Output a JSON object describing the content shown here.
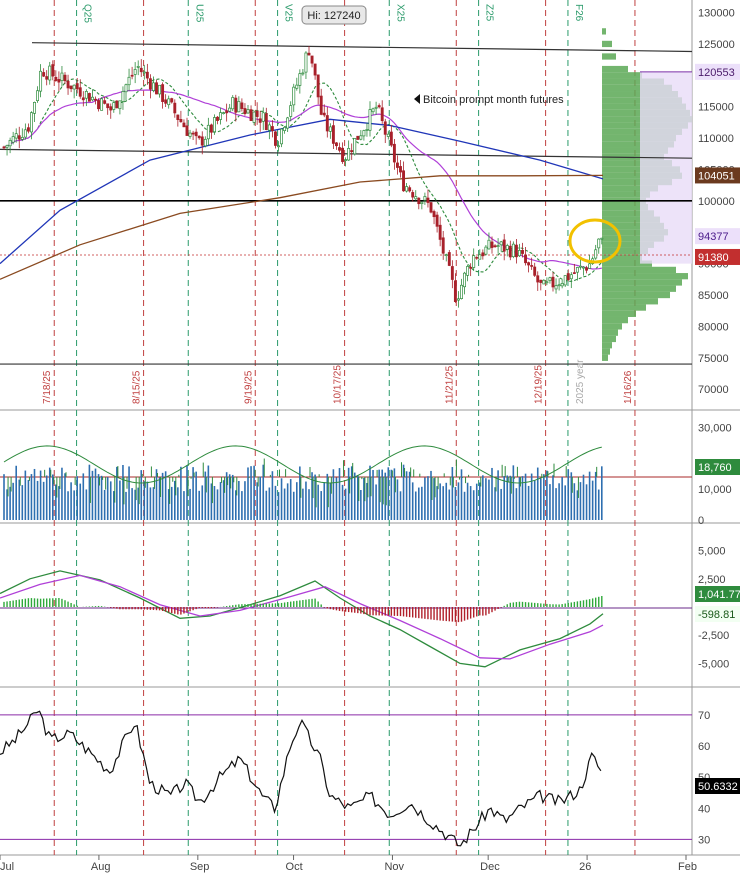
{
  "chart_data": [
    {
      "panel": "price",
      "type": "candlestick",
      "annotation": "Bitcoin prompt month futures",
      "high_label": "Hi: 127240",
      "ylim": [
        67000,
        132000
      ],
      "yticks": [
        130000,
        125000,
        120000,
        115000,
        110000,
        105000,
        100000,
        95000,
        90000,
        85000,
        80000,
        75000,
        70000
      ],
      "ytick_labels": [
        "130000",
        "125000",
        "120000",
        "115000",
        "110000",
        "105000",
        "100000",
        "95000",
        "90000",
        "85000",
        "80000",
        "75000",
        "70000"
      ],
      "price_tags": [
        {
          "label": "120553",
          "value": 120553,
          "color": "#7b2fa8"
        },
        {
          "label": "104051",
          "value": 104051,
          "color": "#6b3a1f"
        },
        {
          "label": "94377",
          "value": 94377,
          "color": "#6a49c8"
        },
        {
          "label": "91380",
          "value": 91380,
          "color": "#c22f2f"
        }
      ],
      "expiry_labels": [
        "Q25",
        "U25",
        "V25",
        "X25",
        "Z25",
        "F26"
      ],
      "date_labels": [
        "7/18/25",
        "8/15/25",
        "9/19/25",
        "10/17/25",
        "11/21/25",
        "12/19/25",
        "2025 year",
        "1/16/26"
      ],
      "close_points": [
        {
          "x": "2025-07-01",
          "y": 108000
        },
        {
          "x": "2025-07-10",
          "y": 112000
        },
        {
          "x": "2025-07-14",
          "y": 121000
        },
        {
          "x": "2025-07-25",
          "y": 118000
        },
        {
          "x": "2025-08-05",
          "y": 114500
        },
        {
          "x": "2025-08-13",
          "y": 121500
        },
        {
          "x": "2025-08-22",
          "y": 116000
        },
        {
          "x": "2025-09-01",
          "y": 109000
        },
        {
          "x": "2025-09-12",
          "y": 115500
        },
        {
          "x": "2025-09-22",
          "y": 113000
        },
        {
          "x": "2025-09-26",
          "y": 109500
        },
        {
          "x": "2025-10-06",
          "y": 124500
        },
        {
          "x": "2025-10-10",
          "y": 113000
        },
        {
          "x": "2025-10-17",
          "y": 107000
        },
        {
          "x": "2025-10-27",
          "y": 115000
        },
        {
          "x": "2025-11-04",
          "y": 103000
        },
        {
          "x": "2025-11-13",
          "y": 99000
        },
        {
          "x": "2025-11-21",
          "y": 84500
        },
        {
          "x": "2025-11-26",
          "y": 91000
        },
        {
          "x": "2025-12-03",
          "y": 93000
        },
        {
          "x": "2025-12-10",
          "y": 92000
        },
        {
          "x": "2025-12-18",
          "y": 86000
        },
        {
          "x": "2025-12-26",
          "y": 88000
        },
        {
          "x": "2026-01-02",
          "y": 90000
        },
        {
          "x": "2026-01-05",
          "y": 94000
        },
        {
          "x": "2026-01-07",
          "y": 91380
        }
      ]
    },
    {
      "panel": "volume",
      "type": "bar",
      "ylim": [
        0,
        35000
      ],
      "yticks": [
        30000,
        10000,
        0
      ],
      "ytick_labels": [
        "30,000",
        "10,000",
        "0"
      ],
      "current_label": "18,760"
    },
    {
      "panel": "macd",
      "type": "line",
      "ylim": [
        -7000,
        7000
      ],
      "yticks": [
        5000,
        2500,
        -2500,
        -5000
      ],
      "ytick_labels": [
        "5,000",
        "2,500",
        "-2,500",
        "-5,000"
      ],
      "current_labels": [
        "1,041.77",
        "-598.81"
      ]
    },
    {
      "panel": "rsi",
      "type": "line",
      "ylim": [
        25,
        78
      ],
      "yticks": [
        70,
        60,
        50,
        40,
        30
      ],
      "ytick_labels": [
        "70",
        "60",
        "50",
        "40",
        "30"
      ],
      "current_label": "50.6332"
    },
    {
      "panel": "x_axis",
      "month_labels": [
        "Jul",
        "Aug",
        "Sep",
        "Oct",
        "Nov",
        "Dec",
        "26",
        "Feb"
      ]
    }
  ],
  "colors": {
    "up": "#2e8b3d",
    "down": "#a8202a",
    "ma_green": "#2e8b3d",
    "ma_purple": "#b040d8",
    "ma_blue": "#2036b8",
    "ma_brown": "#8a4a20",
    "profile": "#5aa855",
    "vlines_red": "#c04040",
    "vlines_green": "#2a9a6a",
    "highlight_circle": "#f2c100"
  }
}
